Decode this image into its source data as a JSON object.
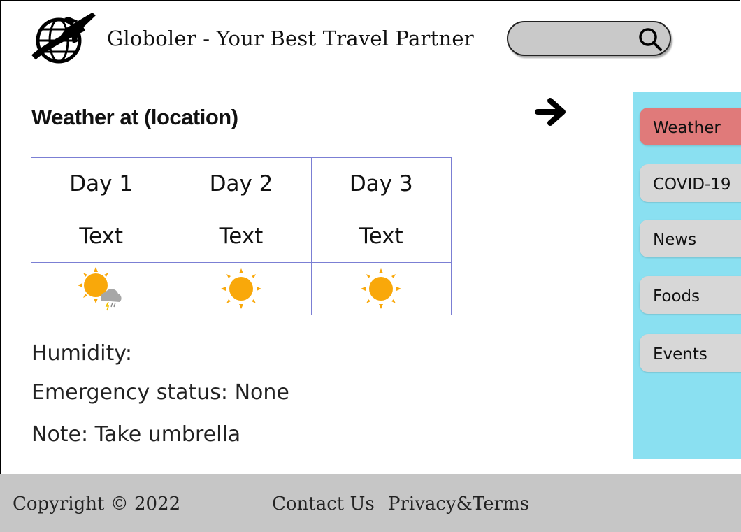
{
  "header": {
    "logo_icon": "globe-airplane-logo-icon",
    "brand_text": "Globoler - Your Best Travel Partner",
    "search": {
      "value": "",
      "placeholder": "",
      "icon": "search-icon"
    }
  },
  "main": {
    "title": "Weather at (location)",
    "arrow_icon": "right-arrow-icon",
    "forecast": {
      "days": [
        "Day 1",
        "Day 2",
        "Day 3"
      ],
      "texts": [
        "Text",
        "Text",
        "Text"
      ],
      "icons": [
        "sun-cloud-storm-icon",
        "sun-icon",
        "sun-icon"
      ]
    },
    "humidity": "Humidity:",
    "emergency": "Emergency status: None",
    "note": "Note: Take umbrella"
  },
  "sidebar": {
    "items": [
      {
        "label": "Weather",
        "active": true
      },
      {
        "label": "COVID-19",
        "active": false
      },
      {
        "label": "News",
        "active": false
      },
      {
        "label": "Foods",
        "active": false
      },
      {
        "label": "Events",
        "active": false
      }
    ]
  },
  "footer": {
    "copyright": "Copyright © 2022",
    "contact": "Contact Us",
    "privacy": "Privacy&Terms"
  },
  "colors": {
    "sidebar_bg": "#8ae0f1",
    "active_item": "#e07a7a",
    "inactive_item": "#d7d7d7",
    "footer_bg": "#c6c6c6",
    "table_border": "#7b7fd4",
    "sun": "#f9a80a"
  }
}
